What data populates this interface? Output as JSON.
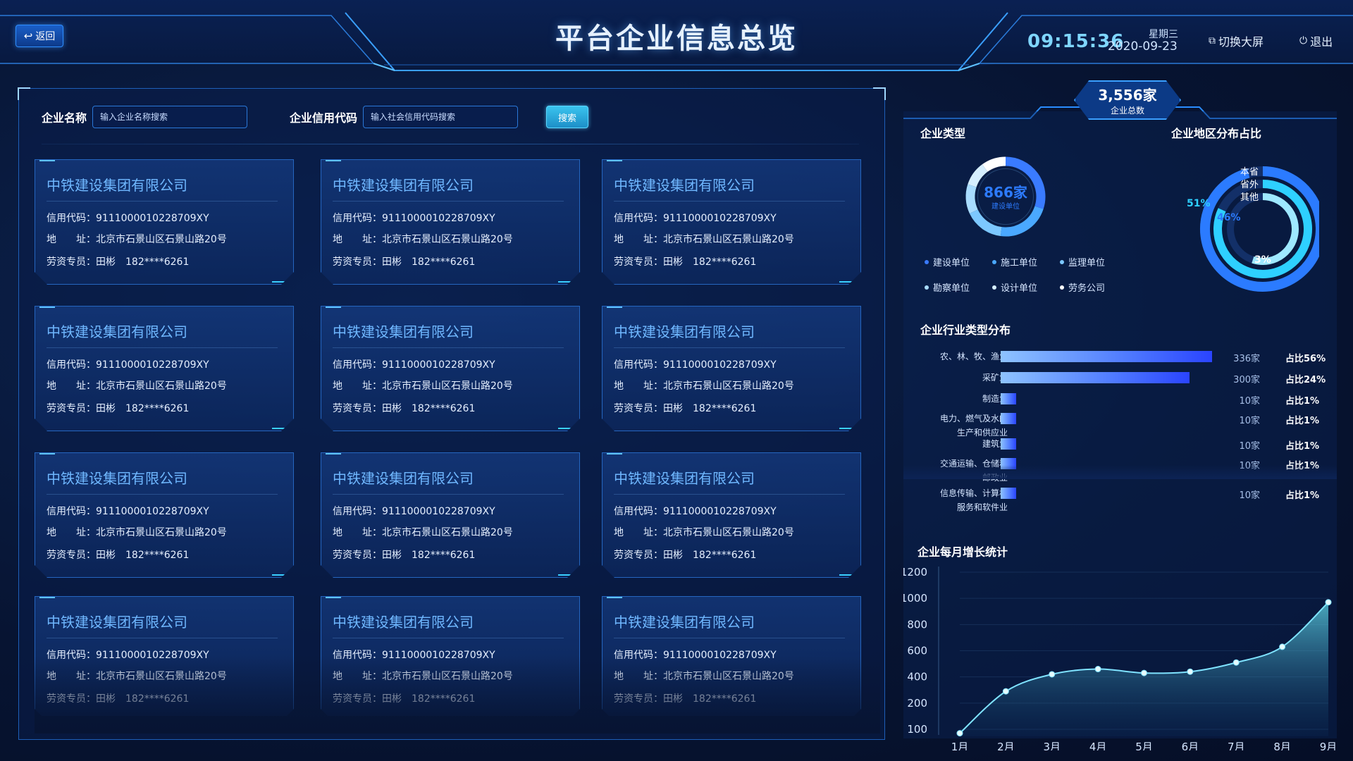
{
  "header": {
    "back_label": "返回",
    "title": "平台企业信息总览",
    "time": "09:15:36",
    "weekday": "星期三",
    "date": "2020-09-23",
    "switch_label": "切换大屏",
    "logout_label": "退出"
  },
  "search": {
    "name_label": "企业名称",
    "name_placeholder": "输入企业名称搜索",
    "code_label": "企业信用代码",
    "code_placeholder": "输入社会信用代码搜索",
    "button_label": "搜索"
  },
  "cards": [
    {
      "name": "中铁建设集团有限公司",
      "credit": "信用代码：9111000010228709XY",
      "address": "地　　址：北京市石景山区石景山路20号",
      "contact": "劳资专员：田彬　182****6261"
    },
    {
      "name": "中铁建设集团有限公司",
      "credit": "信用代码：9111000010228709XY",
      "address": "地　　址：北京市石景山区石景山路20号",
      "contact": "劳资专员：田彬　182****6261"
    },
    {
      "name": "中铁建设集团有限公司",
      "credit": "信用代码：9111000010228709XY",
      "address": "地　　址：北京市石景山区石景山路20号",
      "contact": "劳资专员：田彬　182****6261"
    },
    {
      "name": "中铁建设集团有限公司",
      "credit": "信用代码：9111000010228709XY",
      "address": "地　　址：北京市石景山区石景山路20号",
      "contact": "劳资专员：田彬　182****6261"
    },
    {
      "name": "中铁建设集团有限公司",
      "credit": "信用代码：9111000010228709XY",
      "address": "地　　址：北京市石景山区石景山路20号",
      "contact": "劳资专员：田彬　182****6261"
    },
    {
      "name": "中铁建设集团有限公司",
      "credit": "信用代码：9111000010228709XY",
      "address": "地　　址：北京市石景山区石景山路20号",
      "contact": "劳资专员：田彬　182****6261"
    },
    {
      "name": "中铁建设集团有限公司",
      "credit": "信用代码：9111000010228709XY",
      "address": "地　　址：北京市石景山区石景山路20号",
      "contact": "劳资专员：田彬　182****6261"
    },
    {
      "name": "中铁建设集团有限公司",
      "credit": "信用代码：9111000010228709XY",
      "address": "地　　址：北京市石景山区石景山路20号",
      "contact": "劳资专员：田彬　182****6261"
    },
    {
      "name": "中铁建设集团有限公司",
      "credit": "信用代码：9111000010228709XY",
      "address": "地　　址：北京市石景山区石景山路20号",
      "contact": "劳资专员：田彬　182****6261"
    },
    {
      "name": "中铁建设集团有限公司",
      "credit": "信用代码：9111000010228709XY",
      "address": "地　　址：北京市石景山区石景山路20号",
      "contact": "劳资专员：田彬　182****6261"
    },
    {
      "name": "中铁建设集团有限公司",
      "credit": "信用代码：9111000010228709XY",
      "address": "地　　址：北京市石景山区石景山路20号",
      "contact": "劳资专员：田彬　182****6261"
    },
    {
      "name": "中铁建设集团有限公司",
      "credit": "信用代码：9111000010228709XY",
      "address": "地　　址：北京市石景山区石景山路20号",
      "contact": "劳资专员：田彬　182****6261"
    }
  ],
  "summary": {
    "total_value": "3,556家",
    "total_label": "企业总数"
  },
  "enterprise_types": {
    "title": "企业类型",
    "center_value": "866家",
    "center_label": "建设单位",
    "legend": [
      {
        "label": "建设单位",
        "color": "#3a7bff"
      },
      {
        "label": "施工单位",
        "color": "#4aa8ff"
      },
      {
        "label": "监理单位",
        "color": "#7cc8ff"
      },
      {
        "label": "勘察单位",
        "color": "#a8dcff"
      },
      {
        "label": "设计单位",
        "color": "#d6efff"
      },
      {
        "label": "劳务公司",
        "color": "#ffffff"
      }
    ],
    "segments": [
      0.3,
      0.22,
      0.16,
      0.12,
      0.1,
      0.1
    ]
  },
  "region": {
    "title": "企业地区分布占比",
    "labels": [
      "本省",
      "省外",
      "其他"
    ],
    "values": [
      51,
      46,
      3
    ],
    "value_labels": [
      "51%",
      "46%",
      "3%"
    ],
    "colors": [
      "#2b7bff",
      "#2ed0ff",
      "#9ee8ff"
    ]
  },
  "industry": {
    "title": "企业行业类型分布",
    "rows": [
      {
        "label": "农、林、牧、渔业",
        "count": "336家",
        "pct": "占比56%",
        "value": 336
      },
      {
        "label": "采矿业",
        "count": "300家",
        "pct": "占比24%",
        "value": 300
      },
      {
        "label": "制造业",
        "count": "10家",
        "pct": "占比1%",
        "value": 10
      },
      {
        "label": "电力、燃气及水的\n生产和供应业",
        "count": "10家",
        "pct": "占比1%",
        "value": 10
      },
      {
        "label": "建筑业",
        "count": "10家",
        "pct": "占比1%",
        "value": 10
      },
      {
        "label": "交通运输、仓储和\n邮政业",
        "count": "10家",
        "pct": "占比1%",
        "value": 10
      },
      {
        "label": "信息传输、计算机\n服务和软件业",
        "count": "10家",
        "pct": "占比1%",
        "value": 10
      }
    ]
  },
  "chart_data": {
    "type": "area",
    "title": "企业每月增长统计",
    "categories": [
      "1月",
      "2月",
      "3月",
      "4月",
      "5月",
      "6月",
      "7月",
      "8月",
      "9月"
    ],
    "values": [
      70,
      290,
      420,
      460,
      430,
      440,
      510,
      630,
      970
    ],
    "yticks": [
      100,
      200,
      400,
      600,
      800,
      1000,
      1200
    ],
    "ylim": [
      0,
      1200
    ],
    "line_color": "#7fe3ff"
  }
}
